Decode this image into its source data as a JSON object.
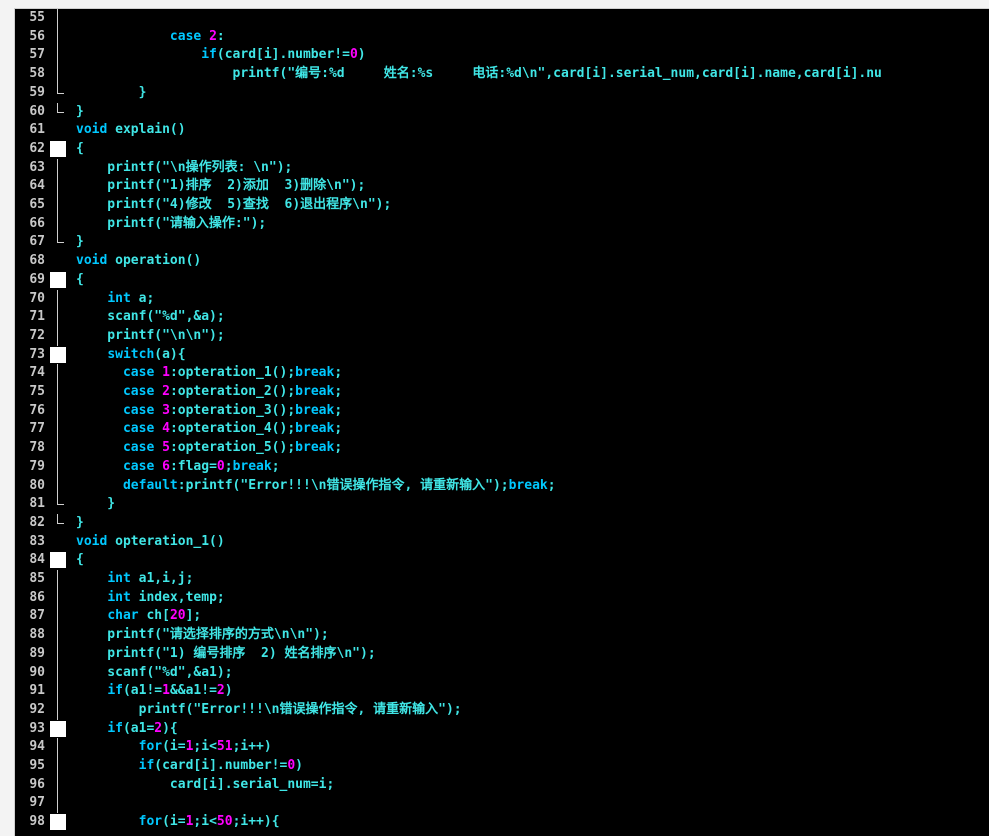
{
  "editor": {
    "lines": [
      {
        "n": "55",
        "fold": "mid",
        "indent": 0,
        "segs": [
          {
            "t": "            ",
            "c": ""
          }
        ]
      },
      {
        "n": "56",
        "fold": "mid",
        "indent": 0,
        "segs": [
          {
            "t": "            ",
            "c": ""
          },
          {
            "t": "case ",
            "c": "kw"
          },
          {
            "t": "2",
            "c": "num"
          },
          {
            "t": ":",
            "c": ""
          }
        ]
      },
      {
        "n": "57",
        "fold": "mid",
        "indent": 0,
        "segs": [
          {
            "t": "                ",
            "c": ""
          },
          {
            "t": "if",
            "c": "kw"
          },
          {
            "t": "(card[i].number!=",
            "c": ""
          },
          {
            "t": "0",
            "c": "num"
          },
          {
            "t": ")",
            "c": ""
          }
        ]
      },
      {
        "n": "58",
        "fold": "mid",
        "indent": 0,
        "segs": [
          {
            "t": "                    printf(\"编号:%d     姓名:%s     电话:%d\\n\",card[i].serial_num,card[i].name,card[i].nu",
            "c": ""
          }
        ]
      },
      {
        "n": "59",
        "fold": "end",
        "indent": 0,
        "segs": [
          {
            "t": "        }",
            "c": ""
          }
        ]
      },
      {
        "n": "60",
        "fold": "end",
        "indent": 0,
        "segs": [
          {
            "t": "}",
            "c": ""
          }
        ]
      },
      {
        "n": "61",
        "fold": "",
        "indent": 0,
        "segs": [
          {
            "t": "void",
            "c": "kw"
          },
          {
            "t": " explain()",
            "c": ""
          }
        ]
      },
      {
        "n": "62",
        "fold": "box",
        "indent": 0,
        "segs": [
          {
            "t": "{",
            "c": ""
          }
        ]
      },
      {
        "n": "63",
        "fold": "mid",
        "indent": 0,
        "segs": [
          {
            "t": "    printf(\"\\n操作列表: \\n\");",
            "c": ""
          }
        ]
      },
      {
        "n": "64",
        "fold": "mid",
        "indent": 0,
        "segs": [
          {
            "t": "    printf(\"1)排序  2)添加  3)删除\\n\");",
            "c": ""
          }
        ]
      },
      {
        "n": "65",
        "fold": "mid",
        "indent": 0,
        "segs": [
          {
            "t": "    printf(\"4)修改  5)查找  6)退出程序\\n\");",
            "c": ""
          }
        ]
      },
      {
        "n": "66",
        "fold": "mid",
        "indent": 0,
        "segs": [
          {
            "t": "    printf(\"请输入操作:\");",
            "c": ""
          }
        ]
      },
      {
        "n": "67",
        "fold": "end",
        "indent": 0,
        "segs": [
          {
            "t": "}",
            "c": ""
          }
        ]
      },
      {
        "n": "68",
        "fold": "",
        "indent": 0,
        "segs": [
          {
            "t": "void",
            "c": "kw"
          },
          {
            "t": " operation()",
            "c": ""
          }
        ]
      },
      {
        "n": "69",
        "fold": "box",
        "indent": 0,
        "segs": [
          {
            "t": "{",
            "c": ""
          }
        ]
      },
      {
        "n": "70",
        "fold": "mid",
        "indent": 0,
        "segs": [
          {
            "t": "    ",
            "c": ""
          },
          {
            "t": "int",
            "c": "kw"
          },
          {
            "t": " a;",
            "c": ""
          }
        ]
      },
      {
        "n": "71",
        "fold": "mid",
        "indent": 0,
        "segs": [
          {
            "t": "    scanf(\"%d\",&a);",
            "c": ""
          }
        ]
      },
      {
        "n": "72",
        "fold": "mid",
        "indent": 0,
        "segs": [
          {
            "t": "    printf(\"\\n\\n\");",
            "c": ""
          }
        ]
      },
      {
        "n": "73",
        "fold": "box",
        "indent": 0,
        "segs": [
          {
            "t": "    ",
            "c": ""
          },
          {
            "t": "switch",
            "c": "kw"
          },
          {
            "t": "(a){",
            "c": ""
          }
        ]
      },
      {
        "n": "74",
        "fold": "mid",
        "indent": 0,
        "segs": [
          {
            "t": "      ",
            "c": ""
          },
          {
            "t": "case ",
            "c": "kw"
          },
          {
            "t": "1",
            "c": "num"
          },
          {
            "t": ":opteration_1();",
            "c": ""
          },
          {
            "t": "break",
            "c": "kw"
          },
          {
            "t": ";",
            "c": ""
          }
        ]
      },
      {
        "n": "75",
        "fold": "mid",
        "indent": 0,
        "segs": [
          {
            "t": "      ",
            "c": ""
          },
          {
            "t": "case ",
            "c": "kw"
          },
          {
            "t": "2",
            "c": "num"
          },
          {
            "t": ":opteration_2();",
            "c": ""
          },
          {
            "t": "break",
            "c": "kw"
          },
          {
            "t": ";",
            "c": ""
          }
        ]
      },
      {
        "n": "76",
        "fold": "mid",
        "indent": 0,
        "segs": [
          {
            "t": "      ",
            "c": ""
          },
          {
            "t": "case ",
            "c": "kw"
          },
          {
            "t": "3",
            "c": "num"
          },
          {
            "t": ":opteration_3();",
            "c": ""
          },
          {
            "t": "break",
            "c": "kw"
          },
          {
            "t": ";",
            "c": ""
          }
        ]
      },
      {
        "n": "77",
        "fold": "mid",
        "indent": 0,
        "segs": [
          {
            "t": "      ",
            "c": ""
          },
          {
            "t": "case ",
            "c": "kw"
          },
          {
            "t": "4",
            "c": "num"
          },
          {
            "t": ":opteration_4();",
            "c": ""
          },
          {
            "t": "break",
            "c": "kw"
          },
          {
            "t": ";",
            "c": ""
          }
        ]
      },
      {
        "n": "78",
        "fold": "mid",
        "indent": 0,
        "segs": [
          {
            "t": "      ",
            "c": ""
          },
          {
            "t": "case ",
            "c": "kw"
          },
          {
            "t": "5",
            "c": "num"
          },
          {
            "t": ":opteration_5();",
            "c": ""
          },
          {
            "t": "break",
            "c": "kw"
          },
          {
            "t": ";",
            "c": ""
          }
        ]
      },
      {
        "n": "79",
        "fold": "mid",
        "indent": 0,
        "segs": [
          {
            "t": "      ",
            "c": ""
          },
          {
            "t": "case ",
            "c": "kw"
          },
          {
            "t": "6",
            "c": "num"
          },
          {
            "t": ":flag=",
            "c": ""
          },
          {
            "t": "0",
            "c": "num"
          },
          {
            "t": ";",
            "c": ""
          },
          {
            "t": "break",
            "c": "kw"
          },
          {
            "t": ";",
            "c": ""
          }
        ]
      },
      {
        "n": "80",
        "fold": "mid",
        "indent": 0,
        "segs": [
          {
            "t": "      ",
            "c": ""
          },
          {
            "t": "default",
            "c": "kw"
          },
          {
            "t": ":printf(\"Error!!!\\n错误操作指令, 请重新输入\");",
            "c": ""
          },
          {
            "t": "break",
            "c": "kw"
          },
          {
            "t": ";",
            "c": ""
          }
        ]
      },
      {
        "n": "81",
        "fold": "end",
        "indent": 0,
        "segs": [
          {
            "t": "    }",
            "c": ""
          }
        ]
      },
      {
        "n": "82",
        "fold": "end",
        "indent": 0,
        "segs": [
          {
            "t": "}",
            "c": ""
          }
        ]
      },
      {
        "n": "83",
        "fold": "",
        "indent": 0,
        "segs": [
          {
            "t": "void",
            "c": "kw"
          },
          {
            "t": " opteration_1()",
            "c": ""
          }
        ]
      },
      {
        "n": "84",
        "fold": "box",
        "indent": 0,
        "segs": [
          {
            "t": "{",
            "c": ""
          }
        ]
      },
      {
        "n": "85",
        "fold": "mid",
        "indent": 0,
        "segs": [
          {
            "t": "    ",
            "c": ""
          },
          {
            "t": "int",
            "c": "kw"
          },
          {
            "t": " a1,i,j;",
            "c": ""
          }
        ]
      },
      {
        "n": "86",
        "fold": "mid",
        "indent": 0,
        "segs": [
          {
            "t": "    ",
            "c": ""
          },
          {
            "t": "int",
            "c": "kw"
          },
          {
            "t": " index,temp;",
            "c": ""
          }
        ]
      },
      {
        "n": "87",
        "fold": "mid",
        "indent": 0,
        "segs": [
          {
            "t": "    ",
            "c": ""
          },
          {
            "t": "char",
            "c": "kw"
          },
          {
            "t": " ch[",
            "c": ""
          },
          {
            "t": "20",
            "c": "num"
          },
          {
            "t": "];",
            "c": ""
          }
        ]
      },
      {
        "n": "88",
        "fold": "mid",
        "indent": 0,
        "segs": [
          {
            "t": "    printf(\"请选择排序的方式\\n\\n\");",
            "c": ""
          }
        ]
      },
      {
        "n": "89",
        "fold": "mid",
        "indent": 0,
        "segs": [
          {
            "t": "    printf(\"1) 编号排序  2) 姓名排序\\n\");",
            "c": ""
          }
        ]
      },
      {
        "n": "90",
        "fold": "mid",
        "indent": 0,
        "segs": [
          {
            "t": "    scanf(\"%d\",&a1);",
            "c": ""
          }
        ]
      },
      {
        "n": "91",
        "fold": "mid",
        "indent": 0,
        "segs": [
          {
            "t": "    ",
            "c": ""
          },
          {
            "t": "if",
            "c": "kw"
          },
          {
            "t": "(a1!=",
            "c": ""
          },
          {
            "t": "1",
            "c": "num"
          },
          {
            "t": "&&a1!=",
            "c": ""
          },
          {
            "t": "2",
            "c": "num"
          },
          {
            "t": ")",
            "c": ""
          }
        ]
      },
      {
        "n": "92",
        "fold": "mid",
        "indent": 0,
        "segs": [
          {
            "t": "        printf(\"Error!!!\\n错误操作指令, 请重新输入\");",
            "c": ""
          }
        ]
      },
      {
        "n": "93",
        "fold": "box",
        "indent": 0,
        "segs": [
          {
            "t": "    ",
            "c": ""
          },
          {
            "t": "if",
            "c": "kw"
          },
          {
            "t": "(a1=",
            "c": ""
          },
          {
            "t": "2",
            "c": "num"
          },
          {
            "t": "){",
            "c": ""
          }
        ]
      },
      {
        "n": "94",
        "fold": "mid",
        "indent": 0,
        "segs": [
          {
            "t": "        ",
            "c": ""
          },
          {
            "t": "for",
            "c": "kw"
          },
          {
            "t": "(i=",
            "c": ""
          },
          {
            "t": "1",
            "c": "num"
          },
          {
            "t": ";i<",
            "c": ""
          },
          {
            "t": "51",
            "c": "num"
          },
          {
            "t": ";i++)",
            "c": ""
          }
        ]
      },
      {
        "n": "95",
        "fold": "mid",
        "indent": 0,
        "segs": [
          {
            "t": "        ",
            "c": ""
          },
          {
            "t": "if",
            "c": "kw"
          },
          {
            "t": "(card[i].number!=",
            "c": ""
          },
          {
            "t": "0",
            "c": "num"
          },
          {
            "t": ")",
            "c": ""
          }
        ]
      },
      {
        "n": "96",
        "fold": "mid",
        "indent": 0,
        "segs": [
          {
            "t": "            card[i].serial_num=i;",
            "c": ""
          }
        ]
      },
      {
        "n": "97",
        "fold": "mid",
        "indent": 0,
        "segs": [
          {
            "t": "",
            "c": ""
          }
        ]
      },
      {
        "n": "98",
        "fold": "box",
        "indent": 0,
        "segs": [
          {
            "t": "        ",
            "c": ""
          },
          {
            "t": "for",
            "c": "kw"
          },
          {
            "t": "(i=",
            "c": ""
          },
          {
            "t": "1",
            "c": "num"
          },
          {
            "t": ";i<",
            "c": ""
          },
          {
            "t": "50",
            "c": "num"
          },
          {
            "t": ";i++){",
            "c": ""
          }
        ]
      }
    ]
  }
}
